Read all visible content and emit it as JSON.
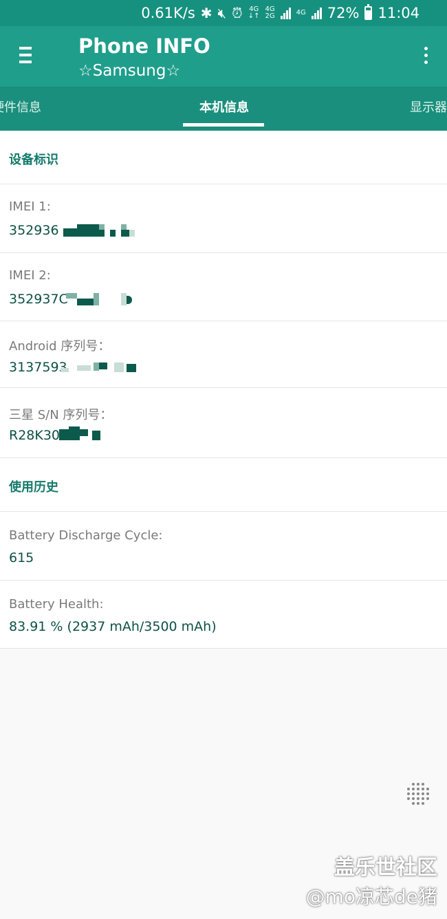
{
  "status_bar": {
    "speed": "0.61K/s",
    "bluetooth_icon": "bluetooth-icon",
    "mute_icon": "mute-icon",
    "alarm_icon": "alarm-icon",
    "net1_top": "4G",
    "net1_bottom": "↓↑",
    "net2_top": "4G",
    "net2_bottom": "2G",
    "net3_top": "4G",
    "battery_percent": "72%",
    "battery_level": 0.72,
    "time": "11:04"
  },
  "app_bar": {
    "title": "Phone INFO",
    "subtitle": "☆Samsung☆"
  },
  "tabs": {
    "left": "硬件信息",
    "center": "本机信息",
    "right": "显示器"
  },
  "sections": {
    "device_id": {
      "header": "设备标识",
      "imei1_label": "IMEI 1:",
      "imei1_value": "352936",
      "imei2_label": "IMEI 2:",
      "imei2_value": "352937C",
      "android_serial_label": "Android 序列号：",
      "android_serial_value": "3137593",
      "samsung_sn_label": "三星 S/N 序列号：",
      "samsung_sn_value": "R28K30"
    },
    "usage_history": {
      "header": "使用历史",
      "discharge_label": "Battery Discharge Cycle:",
      "discharge_value": "615",
      "health_label": "Battery Health:",
      "health_value": "83.91 % (2937 mAh/3500 mAh)"
    }
  },
  "watermark": {
    "line1": "盖乐世社区",
    "line2": "@mo凉芯de猪"
  },
  "colors": {
    "status_bar": "#16917f",
    "app_bar": "#1f9e8b",
    "tab_bar": "#1a8f7d",
    "section_header_text": "#147a6a",
    "value_text": "#0d5145"
  }
}
